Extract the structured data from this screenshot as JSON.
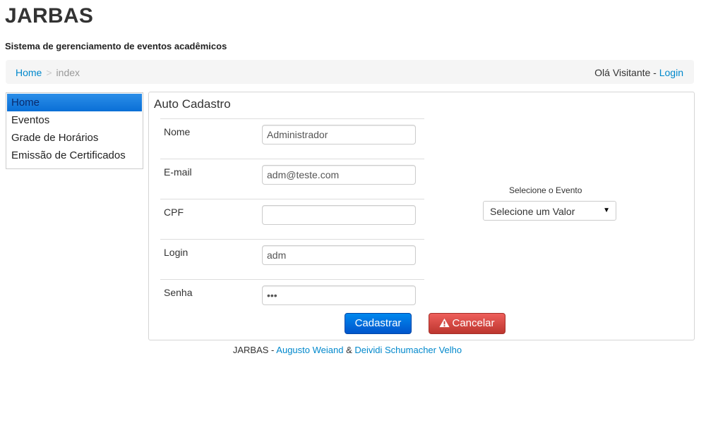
{
  "header": {
    "title": "JARBAS",
    "subtitle": "Sistema de gerenciamento de eventos acadêmicos"
  },
  "breadcrumb": {
    "home": "Home",
    "separator": ">",
    "current": "index"
  },
  "user": {
    "greeting": "Olá Visitante - ",
    "login_link": "Login"
  },
  "sidebar": {
    "items": [
      {
        "label": "Home",
        "active": true
      },
      {
        "label": "Eventos"
      },
      {
        "label": "Grade de Horários"
      },
      {
        "label": "Emissão de Certificados"
      }
    ]
  },
  "form": {
    "title": "Auto Cadastro",
    "fields": [
      {
        "label": "Nome",
        "value": "Administrador"
      },
      {
        "label": "E-mail",
        "value": "adm@teste.com"
      },
      {
        "label": "CPF",
        "value": ""
      },
      {
        "label": "Login",
        "value": "adm"
      },
      {
        "label": "Senha",
        "value": "•••"
      }
    ],
    "event_label": "Selecione o Evento",
    "event_select_value": "Selecione um Valor",
    "save_label": "Cadastrar",
    "cancel_label": "Cancelar"
  },
  "footer": {
    "prefix": "JARBAS - ",
    "author1": "Augusto Weiand",
    "amp": " & ",
    "author2": "Deividi Schumacher Velho"
  },
  "colors": {
    "link": "#0088cc",
    "primary_button": "#0066dd",
    "danger_button": "#da4f49",
    "active_menu": "#1a7fe0"
  },
  "icons": {
    "cancel": "warning-icon",
    "select": "caret-down-icon"
  }
}
